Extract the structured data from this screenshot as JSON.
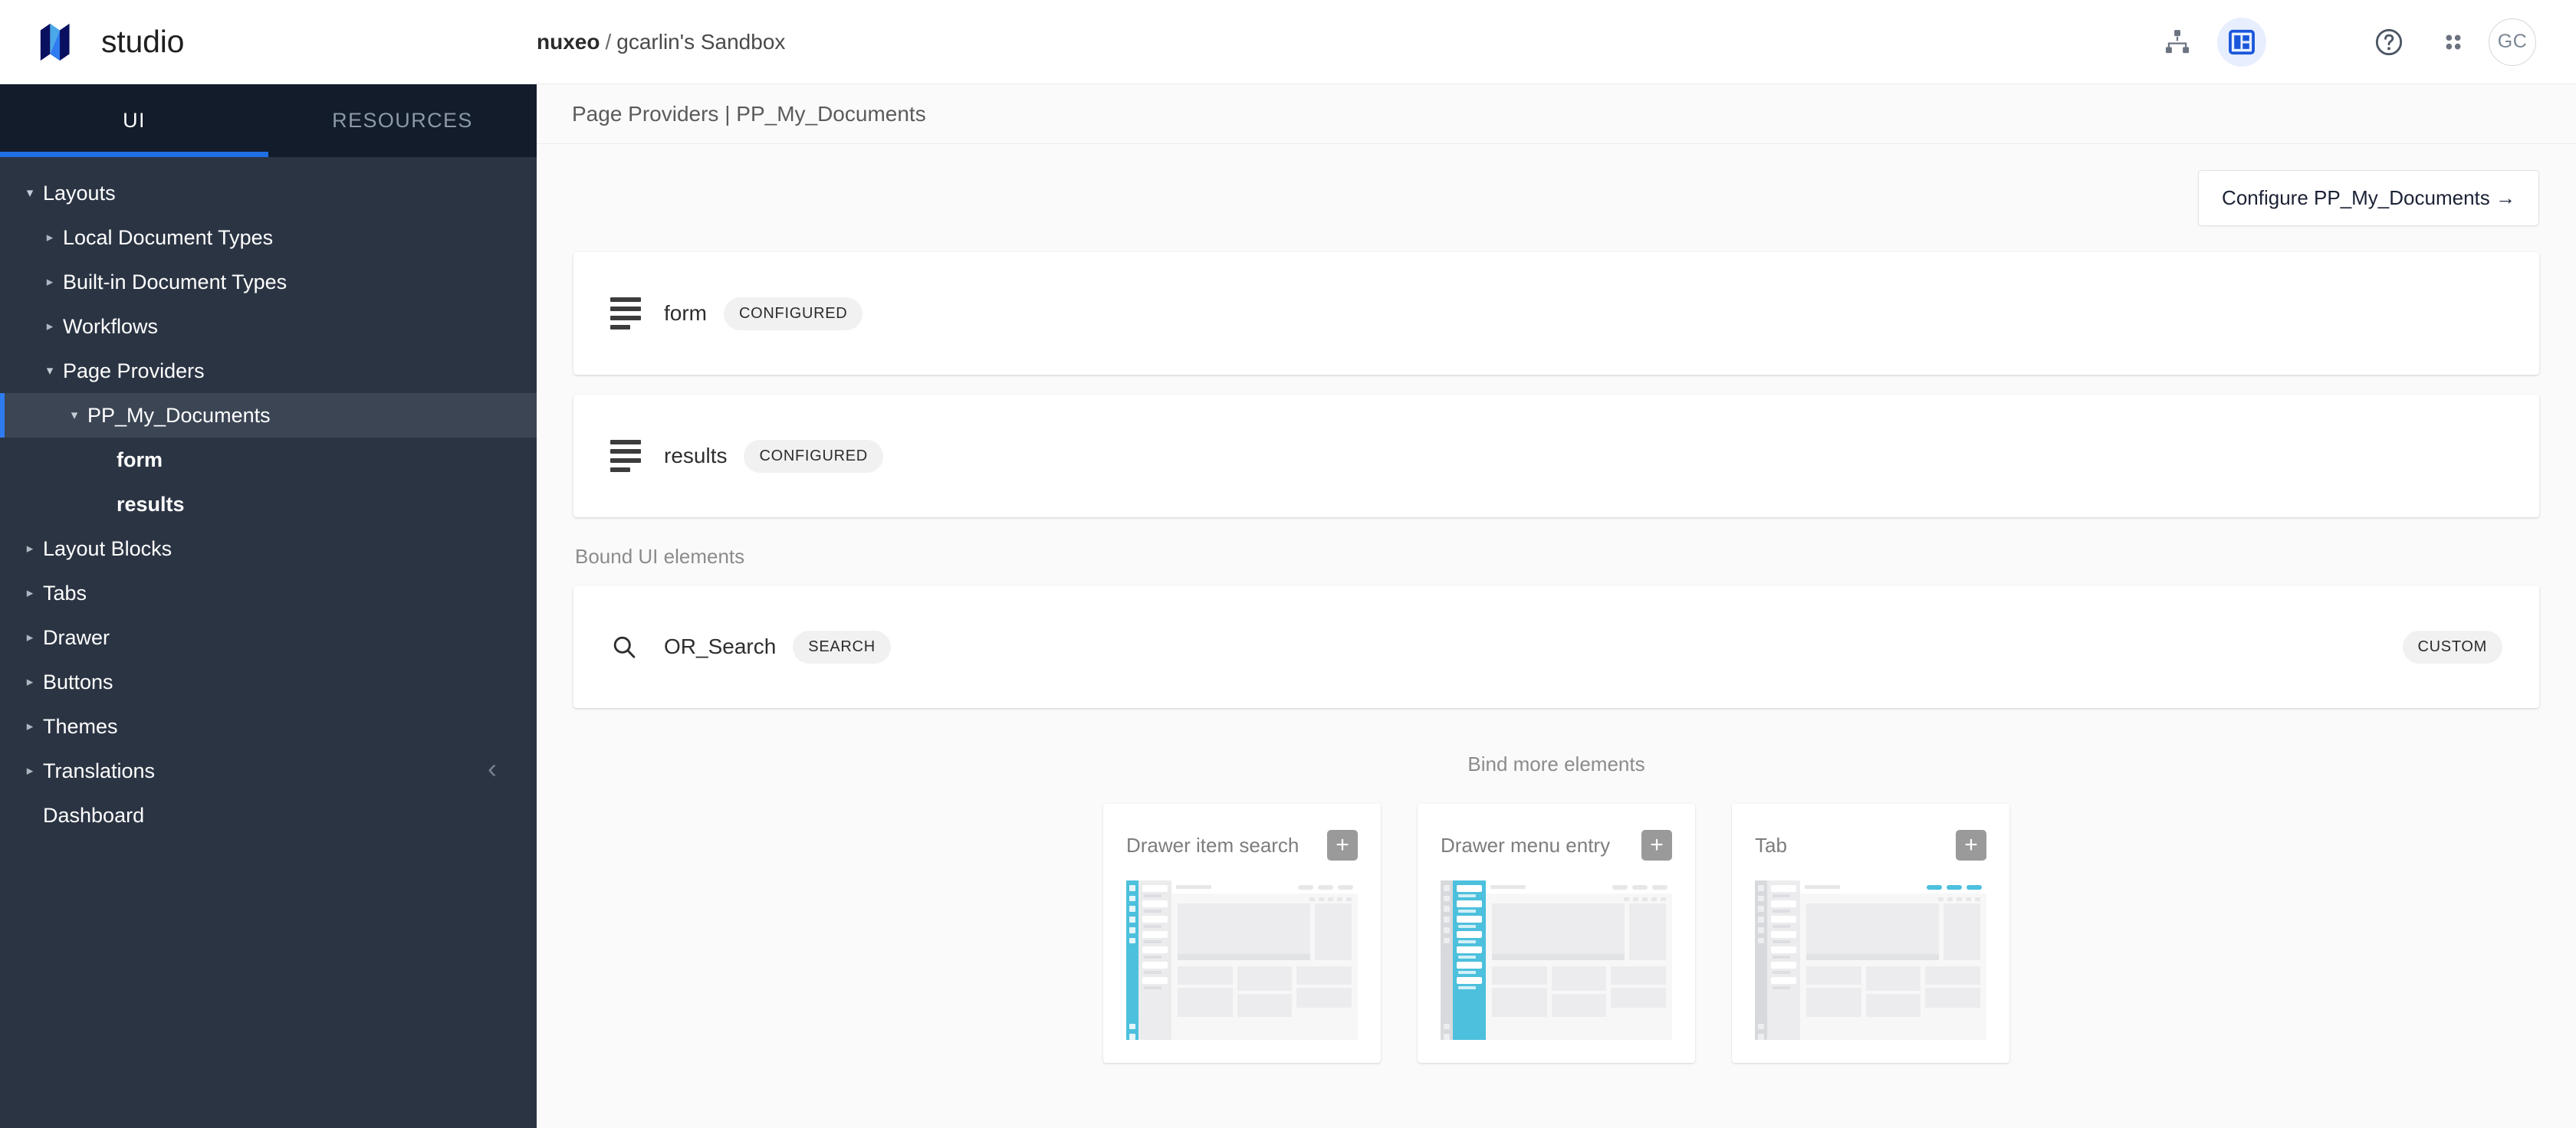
{
  "header": {
    "brand_name": "studio",
    "logo_icon": "nuxeo-logo-icon",
    "breadcrumb": {
      "org": "nuxeo",
      "separator": "/",
      "current": "gcarlin's Sandbox"
    },
    "actions": {
      "hierarchy_icon": "hierarchy-icon",
      "layout_icon": "layout-icon",
      "help_icon": "help-icon",
      "apps_icon": "apps-grid-icon",
      "avatar_initials": "GC"
    },
    "colors": {
      "accent_blue": "#1f6fe5",
      "active_icon_bg": "#e7efff",
      "logo_dark": "#0a1060",
      "logo_light": "#4aa8e8"
    }
  },
  "sidebar": {
    "tabs": [
      {
        "label": "UI",
        "active": true
      },
      {
        "label": "RESOURCES",
        "active": false
      }
    ],
    "collapse_icon": "chevron-left-icon",
    "tree": [
      {
        "label": "Layouts",
        "level": 0,
        "caret": "open"
      },
      {
        "label": "Local Document Types",
        "level": 1,
        "caret": "closed"
      },
      {
        "label": "Built-in Document Types",
        "level": 1,
        "caret": "closed"
      },
      {
        "label": "Workflows",
        "level": 1,
        "caret": "closed"
      },
      {
        "label": "Page Providers",
        "level": 1,
        "caret": "open"
      },
      {
        "label": "PP_My_Documents",
        "level": 2,
        "caret": "open",
        "selected": true
      },
      {
        "label": "form",
        "level": 3,
        "caret": "none",
        "bold": true
      },
      {
        "label": "results",
        "level": 3,
        "caret": "none",
        "bold": true
      },
      {
        "label": "Layout Blocks",
        "level": 0,
        "caret": "closed"
      },
      {
        "label": "Tabs",
        "level": 0,
        "caret": "closed"
      },
      {
        "label": "Drawer",
        "level": 0,
        "caret": "closed"
      },
      {
        "label": "Buttons",
        "level": 0,
        "caret": "closed"
      },
      {
        "label": "Themes",
        "level": 0,
        "caret": "closed"
      },
      {
        "label": "Translations",
        "level": 0,
        "caret": "closed"
      },
      {
        "label": "Dashboard",
        "level": 0,
        "caret": "none"
      }
    ]
  },
  "main": {
    "page_title": "Page Providers | PP_My_Documents",
    "configure_button": "Configure PP_My_Documents →",
    "layout_cards": [
      {
        "icon": "subject-lines-icon",
        "title": "form",
        "badge": "CONFIGURED"
      },
      {
        "icon": "subject-lines-icon",
        "title": "results",
        "badge": "CONFIGURED"
      }
    ],
    "bound_section_label": "Bound UI elements",
    "bound_cards": [
      {
        "icon": "search-icon",
        "title": "OR_Search",
        "badge": "SEARCH",
        "right_badge": "CUSTOM"
      }
    ],
    "bind_more_label": "Bind more elements",
    "bind_more_cards": [
      {
        "label": "Drawer item search",
        "add_icon": "plus-icon",
        "highlight": "rail"
      },
      {
        "label": "Drawer menu entry",
        "add_icon": "plus-icon",
        "highlight": "side"
      },
      {
        "label": "Tab",
        "add_icon": "plus-icon",
        "highlight": "tabs"
      }
    ]
  }
}
